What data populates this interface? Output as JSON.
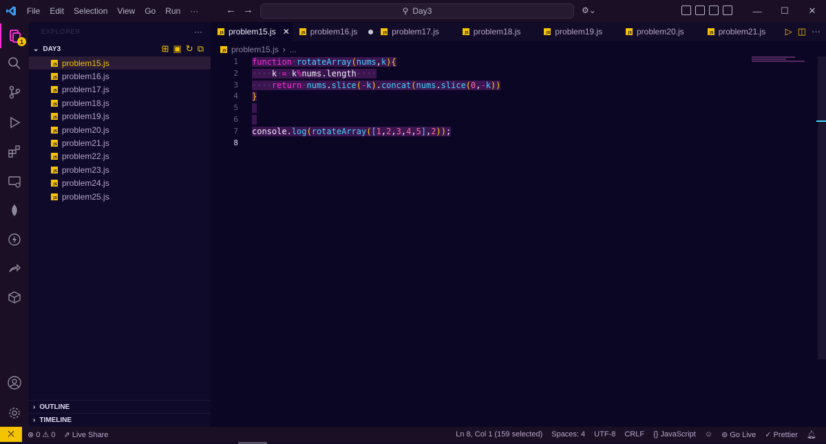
{
  "titlebar": {
    "menu": [
      "File",
      "Edit",
      "Selection",
      "View",
      "Go",
      "Run",
      "···"
    ],
    "search": "Day3"
  },
  "activity": {
    "explorer_badge": "1"
  },
  "sidebar": {
    "title": "EXPLORER",
    "folder": "DAY3",
    "files": [
      "problem15.js",
      "problem16.js",
      "problem17.js",
      "problem18.js",
      "problem19.js",
      "problem20.js",
      "problem21.js",
      "problem22.js",
      "problem23.js",
      "problem24.js",
      "problem25.js"
    ],
    "outline": "OUTLINE",
    "timeline": "TIMELINE"
  },
  "tabs": [
    "problem15.js",
    "problem16.js",
    "problem17.js",
    "problem18.js",
    "problem19.js",
    "problem20.js",
    "problem21.js"
  ],
  "breadcrumb": {
    "file": "problem15.js",
    "more": "..."
  },
  "editor": {
    "line_numbers": [
      "1",
      "2",
      "3",
      "4",
      "5",
      "6",
      "7",
      "8"
    ]
  },
  "status": {
    "problems": "0",
    "warnings": "0",
    "live_share": "Live Share",
    "cursor": "Ln 8, Col 1 (159 selected)",
    "spaces": "Spaces: 4",
    "encoding": "UTF-8",
    "eol": "CRLF",
    "language": "JavaScript",
    "golive": "Go Live",
    "prettier": "Prettier"
  },
  "colors": {
    "accent": "#ff2bd6",
    "yellow": "#f5c400",
    "cyan": "#41d6ff",
    "bg": "#0a0624"
  }
}
